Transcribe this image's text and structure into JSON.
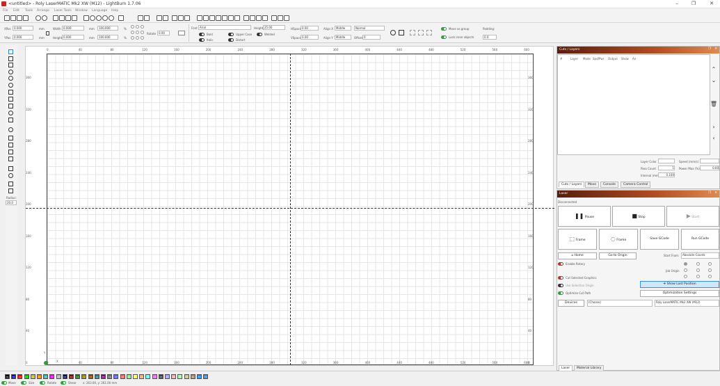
{
  "window": {
    "title": "<untitled> - Roly LaserMATIC Mk2 XW (M12) - LightBurn 1.7.06"
  },
  "menu": [
    "File",
    "Edit",
    "Tools",
    "Arrange",
    "Laser Tools",
    "Window",
    "Language",
    "Help"
  ],
  "props": {
    "xpos_label": "XPos",
    "xpos_value": "0.000",
    "ypos_label": "YPos",
    "ypos_value": "0.000",
    "unit": "mm",
    "width_label": "Width",
    "width_value": "0.000",
    "height_label": "Height",
    "height_value": "0.000",
    "scale_w": "100.000",
    "scale_h": "100.000",
    "pct": "%",
    "rotate_label": "Rotate",
    "rotate_value": "0.00",
    "font_label": "Font",
    "font_value": "Arial",
    "font_height_label": "Height",
    "font_height_value": "25.00",
    "bold": "Bold",
    "italic": "Italic",
    "upper": "Upper Case",
    "welded": "Welded",
    "distort": "Distort",
    "hspace_label": "HSpace",
    "hspace_value": "0.00",
    "vspace_label": "VSpace",
    "vspace_value": "0.00",
    "alignx_label": "Align X",
    "alignx_value": "Middle",
    "aligny_label": "Align Y",
    "aligny_value": "Middle",
    "normal_value": "Normal",
    "offset_label": "Offset",
    "offset_value": "0",
    "move_group": "Move as group",
    "lock_inner": "Lock inner objects",
    "padding_label": "Padding:",
    "padding_value": "0.0"
  },
  "left": {
    "radius_label": "Radius:",
    "radius_value": "20.0"
  },
  "ruler": {
    "x": [
      "0",
      "40",
      "80",
      "120",
      "160",
      "200",
      "240",
      "280",
      "320",
      "360",
      "400",
      "440",
      "480",
      "520",
      "560",
      "600"
    ],
    "y": [
      "360",
      "320",
      "280",
      "240",
      "200",
      "160",
      "120",
      "80",
      "40",
      "0"
    ],
    "xaxis": "X",
    "yaxis": "Y"
  },
  "cuts": {
    "title": "Cuts / Layers",
    "cols": [
      "#",
      "Layer",
      "Mode",
      "Spd/Pwr",
      "Output",
      "Show",
      "Air"
    ],
    "layer_color": "Layer Color",
    "speed": "Speed (mm/s)",
    "pass_count": "Pass Count",
    "pass_value": "1",
    "power_max": "Power Max (%)",
    "power_value": "0.00",
    "interval": "Interval (mm)",
    "interval_value": "0.100",
    "tabs": [
      "Cuts / Layers",
      "Move",
      "Console",
      "Camera Control"
    ]
  },
  "laser": {
    "title": "Laser",
    "status": "Disconnected",
    "pause": "Pause",
    "stop": "Stop",
    "start": "Start",
    "frame1": "Frame",
    "frame2": "Frame",
    "save_gcode": "Save GCode",
    "run_gcode": "Run GCode",
    "home": "Home",
    "go_origin": "Go to Origin",
    "start_from_label": "Start From:",
    "start_from_value": "Absolute Coords",
    "job_origin": "Job Origin",
    "enable_rotary": "Enable Rotary",
    "cut_selected": "Cut Selected Graphics",
    "use_selection": "Use Selection Origin",
    "optimize": "Optimize Cut Path",
    "show_last": "Show Last Position",
    "opt_settings": "Optimization Settings",
    "devices": "Devices",
    "com_value": "(Choose)",
    "device_value": "Roly LaserMATIC Mk2 XW (M12)",
    "tabs": [
      "Laser",
      "Material Library"
    ]
  },
  "palette": [
    "00",
    "01",
    "02",
    "03",
    "04",
    "05",
    "06",
    "07",
    "08",
    "09",
    "10",
    "11",
    "12",
    "13",
    "14",
    "15",
    "16",
    "17",
    "18",
    "19",
    "20",
    "21",
    "22",
    "23",
    "24",
    "25",
    "26",
    "27",
    "28",
    "29",
    "T1",
    "T2"
  ],
  "palette_colors": [
    "#000000",
    "#0000ff",
    "#ff0000",
    "#00c000",
    "#c0c000",
    "#ff8000",
    "#00c0c0",
    "#ff00ff",
    "#b0b0b0",
    "#00008b",
    "#8b0000",
    "#008b00",
    "#8b8b00",
    "#8b4500",
    "#008b8b",
    "#8b008b",
    "#707070",
    "#6060ff",
    "#ff6060",
    "#60ff60",
    "#ffff60",
    "#ffa060",
    "#60ffff",
    "#ff60ff",
    "#404040",
    "#a0a0ff",
    "#ffa0a0",
    "#a0ffa0",
    "#c0c080",
    "#c08060",
    "#1e90ff",
    "#1e90ff"
  ],
  "status": {
    "move": "Move",
    "size": "Size",
    "rotate": "Rotate",
    "shear": "Shear",
    "coords": "x: 263.00, y: 261.00 mm"
  }
}
